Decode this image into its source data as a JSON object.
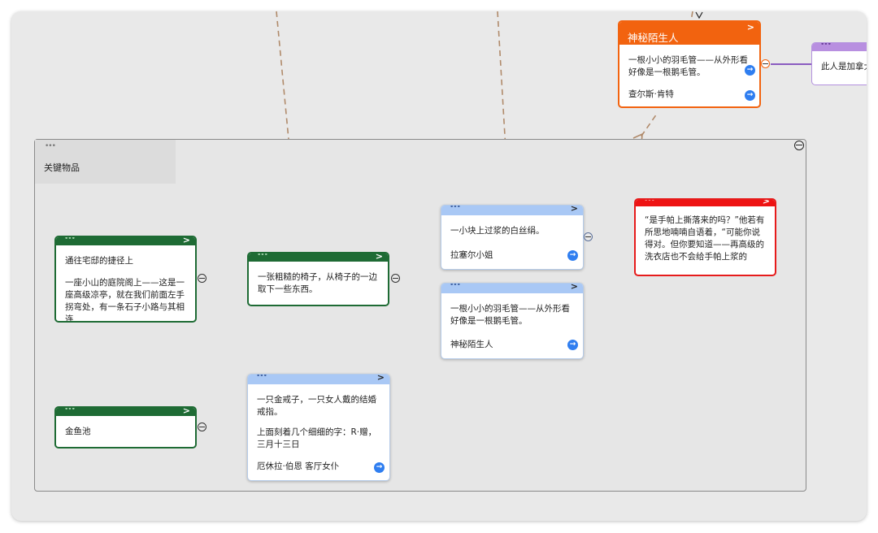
{
  "group": {
    "title": "关键物品",
    "dots": "•••"
  },
  "cards": {
    "shortcut": {
      "header_dots": "•••",
      "chevron": ">",
      "paragraphs": [
        "通往宅邸的捷径上",
        "一座小山的庭院阁上——这是一座高级凉亭，就在我们前面左手拐弯处，有一条石子小路与其相连"
      ]
    },
    "pond": {
      "header_dots": "•••",
      "chevron": ">",
      "paragraphs": [
        "金鱼池"
      ]
    },
    "chair": {
      "header_dots": "•••",
      "chevron": ">",
      "paragraphs": [
        "一张粗糙的椅子，从椅子的一边取下一些东西。"
      ]
    },
    "silk": {
      "header_dots": "•••",
      "chevron": ">",
      "paragraphs": [
        "一小块上过浆的白丝绢。"
      ],
      "ref": "拉塞尔小姐"
    },
    "feather": {
      "header_dots": "•••",
      "chevron": ">",
      "paragraphs": [
        "一根小小的羽毛管——从外形看好像是一根鹅毛管。"
      ],
      "ref": "神秘陌生人"
    },
    "ring": {
      "header_dots": "•••",
      "chevron": ">",
      "paragraphs": [
        "一只金戒子，一只女人戴的结婚戒指。",
        "上面刻着几个细细的字：R·赠，三月十三日"
      ],
      "ref": "厄休拉·伯恩  客厅女仆"
    },
    "quote": {
      "header_dots": "•••",
      "chevron": ">",
      "paragraphs": [
        "“是手帕上撕落来的吗？”他若有所思地喃喃自语着，“可能你说得对。但你要知道——再高级的洗衣店也不会给手帕上浆的"
      ]
    },
    "stranger": {
      "title": "神秘陌生人",
      "chevron": ">",
      "paragraphs": [
        "一根小小的羽毛管——从外形看好像是一根鹅毛管。"
      ],
      "ref": "查尔斯·肯特"
    },
    "canada": {
      "header_dots": "•••",
      "paragraphs": [
        "此人是加拿大"
      ]
    }
  },
  "go_icon": "→",
  "colors": {
    "green": "#1e6b34",
    "blue": "#a9c8f5",
    "red": "#ee1313",
    "orange": "#f2630f",
    "purple": "#b88fe0",
    "dashed_link": "#b08a6a"
  }
}
